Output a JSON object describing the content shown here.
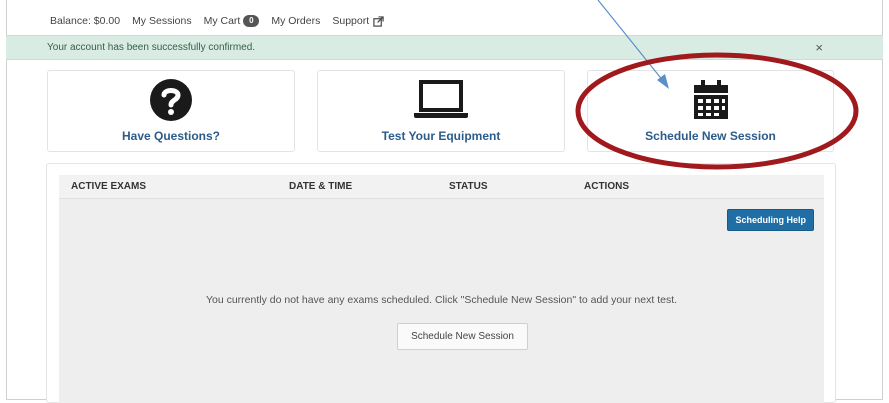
{
  "topnav": {
    "balance": "Balance: $0.00",
    "my_sessions": "My Sessions",
    "my_cart": "My Cart",
    "cart_count": "0",
    "my_orders": "My Orders",
    "support": "Support"
  },
  "alert": {
    "message": "Your account has been successfully confirmed.",
    "close": "×"
  },
  "cards": {
    "questions": {
      "label": "Have Questions?",
      "icon": "question-circle-icon"
    },
    "equipment": {
      "label": "Test Your Equipment",
      "icon": "laptop-icon"
    },
    "schedule": {
      "label": "Schedule New Session",
      "icon": "calendar-icon"
    }
  },
  "table": {
    "headers": [
      "ACTIVE EXAMS",
      "DATE & TIME",
      "STATUS",
      "ACTIONS"
    ],
    "help_button": "Scheduling Help",
    "empty_message": "You currently do not have any exams scheduled. Click \"Schedule New Session\" to add your next test.",
    "schedule_button": "Schedule New Session"
  },
  "colors": {
    "alert_bg": "#d8ece3",
    "card_label": "#2b5c8a",
    "primary_button": "#1f6ea5",
    "annotation_circle": "#a0191c",
    "annotation_arrow": "#5b8fc9"
  }
}
